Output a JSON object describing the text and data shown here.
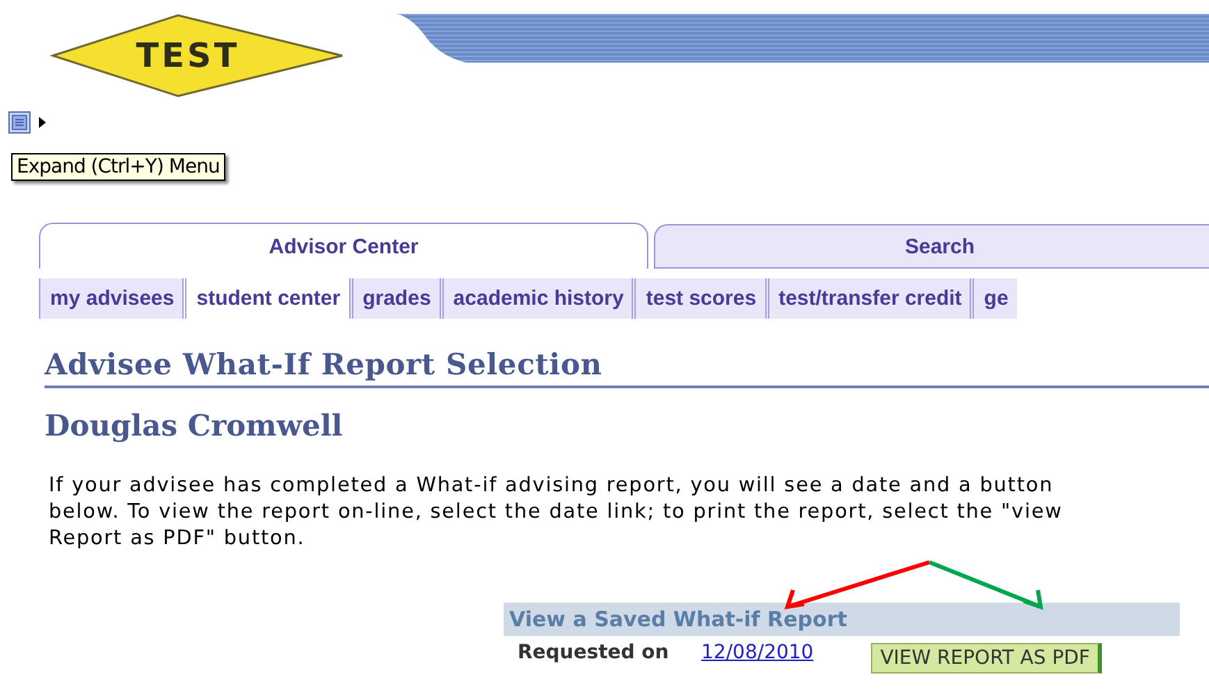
{
  "logo": {
    "text": "TEST"
  },
  "menu_tooltip": "Expand (Ctrl+Y) Menu",
  "tabs": [
    {
      "label": "Advisor Center",
      "selected": true
    },
    {
      "label": "Search",
      "selected": false
    }
  ],
  "subtabs": [
    {
      "label": "my advisees",
      "selected": false
    },
    {
      "label": "student center",
      "selected": true
    },
    {
      "label": "grades",
      "selected": false
    },
    {
      "label": "academic history",
      "selected": false
    },
    {
      "label": "test scores",
      "selected": false
    },
    {
      "label": "test/transfer credit",
      "selected": false
    },
    {
      "label": "ge",
      "selected": false
    }
  ],
  "page_title": "Advisee What-If Report Selection",
  "student_name": "Douglas Cromwell",
  "instructions": "If your advisee has completed a What-if advising report, you will see a date and a button below. To view the report on-line, select the date link; to print the report, select the \"view Report as PDF\" button.",
  "report_table": {
    "title": "View a Saved What-if Report",
    "rows": [
      {
        "label": "Requested on",
        "date": "12/08/2010",
        "button": "VIEW REPORT AS PDF"
      }
    ]
  },
  "annotations": [
    {
      "kind": "arrow",
      "color": "#ff0000"
    },
    {
      "kind": "arrow",
      "color": "#00a650"
    }
  ]
}
